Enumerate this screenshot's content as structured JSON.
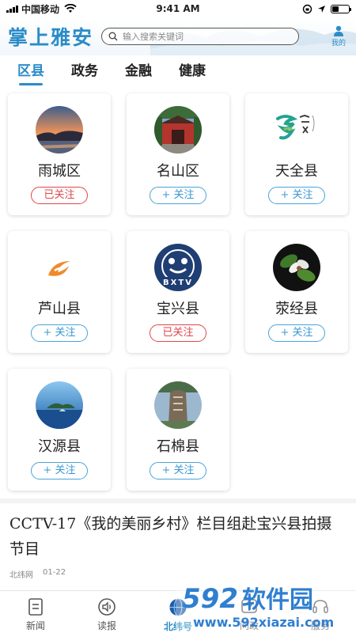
{
  "status_bar": {
    "carrier": "中国移动",
    "time": "9:41 AM"
  },
  "header": {
    "app_title": "掌上雅安",
    "search_placeholder": "输入搜索关键词",
    "me_label": "我的"
  },
  "tabs": [
    {
      "label": "区县",
      "active": true
    },
    {
      "label": "政务",
      "active": false
    },
    {
      "label": "金融",
      "active": false
    },
    {
      "label": "健康",
      "active": false
    }
  ],
  "counties": [
    {
      "name": "雨城区",
      "button": "已关注",
      "followed": true,
      "icon": "sunset-lake-photo"
    },
    {
      "name": "名山区",
      "button": "+ 关注",
      "followed": false,
      "icon": "temple-gate-photo"
    },
    {
      "name": "天全县",
      "button": "+ 关注",
      "followed": false,
      "icon": "tianquan-logo"
    },
    {
      "name": "芦山县",
      "button": "+ 关注",
      "followed": false,
      "icon": "orange-swoosh-logo"
    },
    {
      "name": "宝兴县",
      "button": "已关注",
      "followed": true,
      "icon": "bxtv-panda-logo"
    },
    {
      "name": "荥经县",
      "button": "+ 关注",
      "followed": false,
      "icon": "dove-tree-flower-photo"
    },
    {
      "name": "汉源县",
      "button": "+ 关注",
      "followed": false,
      "icon": "lake-island-photo"
    },
    {
      "name": "石棉县",
      "button": "+ 关注",
      "followed": false,
      "icon": "stone-monument-photo"
    }
  ],
  "news": {
    "title": "CCTV-17《我的美丽乡村》栏目组赴宝兴县拍摄节目",
    "source": "北纬网",
    "date": "01-22"
  },
  "bottom_nav": [
    {
      "label": "新闻",
      "icon": "newspaper-icon",
      "active": false
    },
    {
      "label": "读报",
      "icon": "speaker-icon",
      "active": false
    },
    {
      "label": "北纬号",
      "icon": "globe-icon",
      "active": true
    },
    {
      "label": "问政",
      "icon": "question-icon",
      "active": false
    },
    {
      "label": "服务",
      "icon": "service-icon",
      "active": false
    }
  ],
  "watermark": {
    "text": "592软件园",
    "url": "www.592xiazai.com"
  },
  "colors": {
    "accent": "#2a8cc8",
    "followed": "#e0464b",
    "follow": "#3a97d2"
  }
}
